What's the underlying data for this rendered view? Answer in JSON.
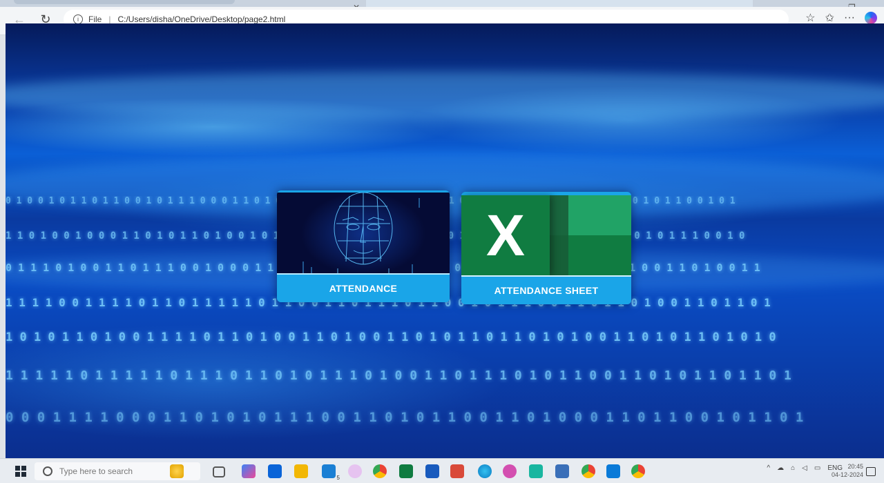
{
  "browser": {
    "url_scheme_label": "File",
    "url": "C:/Users/disha/OneDrive/Desktop/page2.html"
  },
  "cards": [
    {
      "label": "ATTENDANCE",
      "icon": "face-scan-icon"
    },
    {
      "label": "ATTENDANCE SHEET",
      "icon": "excel-icon"
    }
  ],
  "excel_letter": "X",
  "taskbar": {
    "search_placeholder": "Type here to search",
    "badge": "5",
    "lang": "ENG",
    "time": "20:45",
    "date": "04-12-2024"
  },
  "binary_rows": [
    "0 1 0 0 1 0 1 1 0 1 1 0 0 1 0 1 1 1 0 0 0 1 1 0 1 0 1 1 1 0 0 1 0 1 1 0 1 0 0 0 1 1 0 1 1 0 1 0 1 0 0 1 1 1 0 0 1 1 0 1 0 1 1 0 0 1 0 1",
    "1 1 0 1 0 0 1 0 0 0 1 1 0 1 0 1 1 0 1 0 0 1 0 1 1 1 0 0 1 0 1 0 0 1 1 1 0 1 0 1 1 0 0 1 0 1 0 0 1 1 0 1 1 0 0 1 0 1 1 1 0 0 1 0",
    "0 1 1 1 0 1 0 0 1 1 0 1 1 1 0 0 1 0 0 0 1 1 1 0 0 1 1 0 1 0 1 0 0 1 1 0 0 0 1 1 1 0 1 1 0 0 1 1 1 0 1 0 0 1 1 0 1 0 0 1 1",
    "1 1 1 1 0 0 1 1 1 1 0 1 1 0 1 1 1 1 1 0 1 1 0 0 1 1 0 1 1 1 0 1 1 0 0 1 0 1 1 1 0 0 1 1 0 1 1 0 1 0 0 1 1 0 1 1 0 1",
    "1 0 1 0 1 1 0 1 0 0 1 1 1 1 0 1 1 0 1 0 0 1 1 0 1 0 0 1 1 0 1 0 1 1 0 1 1 0 1 0 1 0 0 1 1 0 1 0 1 1 0 1 0 1 0",
    "1 1 1 1 1 0 1 1 1 1 1 0 1 1 1 0 1 1 0 1 0 1 1 1 0 1 0 0 1 1 0 1 1 1 0 1 0 1 1 0 0 1 1 0 1 0 1 1 0 1 1 0 1",
    "0 0 0 1 1 1 1 0 0 0 1 1 0 1 0 1 0 1 1 1 0 0 1 1 0 1 0 1 1 0 0 1 1 0 1 0 0 0 1 1 0 1 1 0 0 1 0 1 1 0 1"
  ]
}
